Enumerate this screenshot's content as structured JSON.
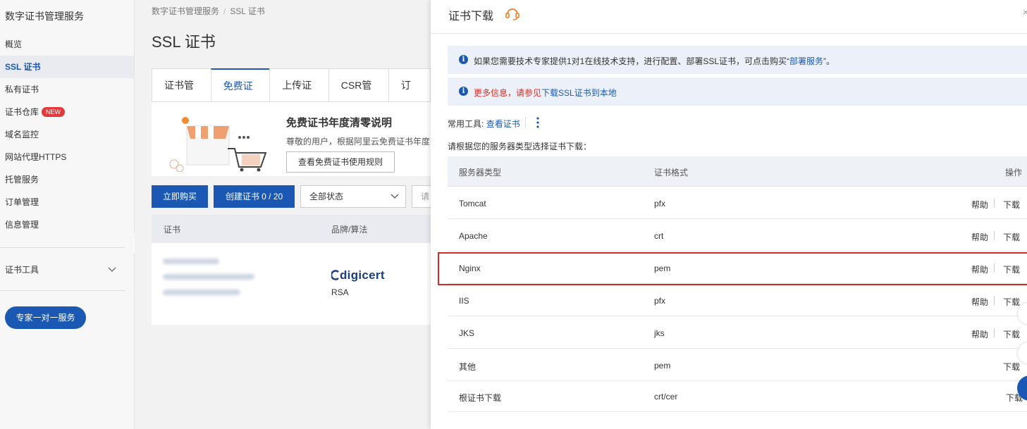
{
  "sidebar": {
    "title": "数字证书管理服务",
    "items": [
      {
        "label": "概览"
      },
      {
        "label": "SSL 证书",
        "active": true
      },
      {
        "label": "私有证书"
      },
      {
        "label": "证书仓库",
        "badge": "NEW"
      },
      {
        "label": "域名监控"
      },
      {
        "label": "网站代理HTTPS"
      },
      {
        "label": "托管服务"
      },
      {
        "label": "订单管理"
      },
      {
        "label": "信息管理"
      }
    ],
    "tools_label": "证书工具",
    "expert_button": "专家一对一服务"
  },
  "main": {
    "breadcrumb": [
      "数字证书管理服务",
      "SSL 证书"
    ],
    "title": "SSL 证书",
    "tabs": [
      "证书管理",
      "免费证书",
      "上传证书",
      "CSR管理",
      "订单"
    ],
    "active_tab": "免费证书",
    "notice": {
      "title": "免费证书年度清零说明",
      "text": "尊敬的用户，根据阿里云免费证书年度",
      "button": "查看免费证书使用规则"
    },
    "buy_button": "立即购买",
    "create_button": "创建证书 0 / 20",
    "status_select": "全部状态",
    "search_stub": "请",
    "list_headers": [
      "证书",
      "品牌/算法"
    ],
    "row": {
      "brand": "digicert",
      "algorithm": "RSA"
    }
  },
  "drawer": {
    "title": "证书下载",
    "close": "×",
    "info1": {
      "before": "如果您需要技术专家提供1对1在线技术支持，进行配置、部署SSL证书，可点击购买“",
      "link": "部署服务",
      "after": "”。"
    },
    "info2": {
      "red": "更多信息，请参见",
      "link": "下载SSL证书到本地"
    },
    "tools_label": "常用工具:",
    "tools_link": "查看证书",
    "instruction": "请根据您的服务器类型选择证书下载：",
    "table": {
      "headers": [
        "服务器类型",
        "证书格式",
        "操作"
      ],
      "help_label": "帮助",
      "download_label": "下载",
      "rows": [
        {
          "server": "Tomcat",
          "format": "pfx",
          "help": true
        },
        {
          "server": "Apache",
          "format": "crt",
          "help": true
        },
        {
          "server": "Nginx",
          "format": "pem",
          "help": true,
          "highlighted": true
        },
        {
          "server": "IIS",
          "format": "pfx",
          "help": true
        },
        {
          "server": "JKS",
          "format": "jks",
          "help": true
        },
        {
          "server": "其他",
          "format": "pem",
          "help": false
        },
        {
          "server": "根证书下载",
          "format": "crt/cer",
          "help": false
        }
      ]
    }
  },
  "colors": {
    "primary": "#1a58b4",
    "highlight": "#d3292b",
    "badge": "#e4393c",
    "headset": "#f47a20"
  }
}
